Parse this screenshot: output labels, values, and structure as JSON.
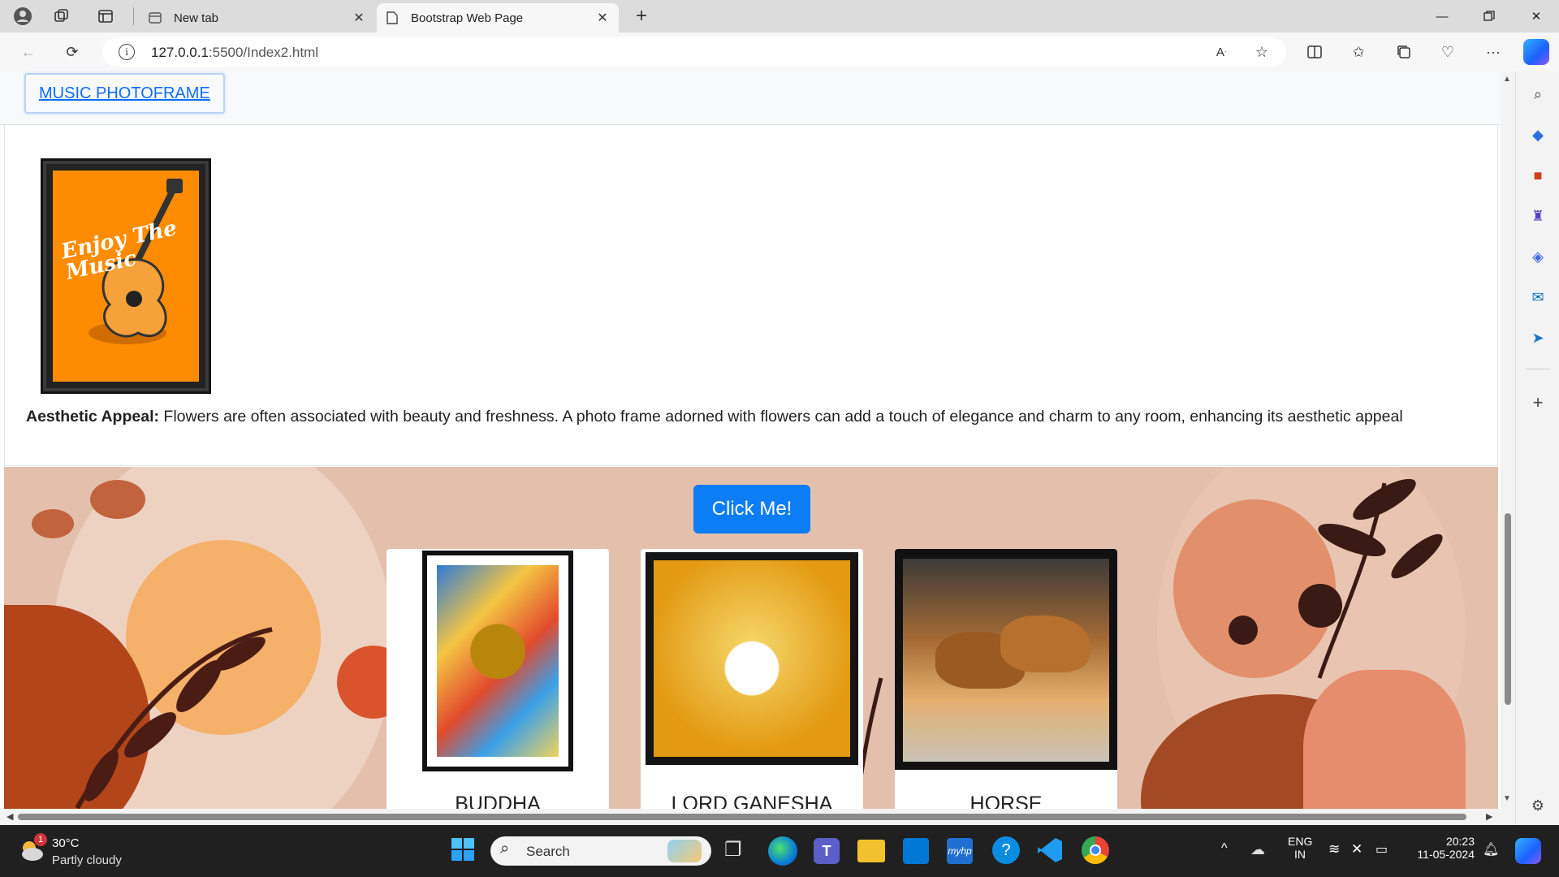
{
  "browser": {
    "tabs": [
      {
        "title": "New tab",
        "active": false
      },
      {
        "title": "Bootstrap Web Page",
        "active": true
      }
    ],
    "url_host": "127.0.0.1",
    "url_path": ":5500/Index2.html"
  },
  "page": {
    "nav_link": "MUSIC PHOTOFRAME",
    "poster_text": "Enjoy The Music",
    "desc_bold": "Aesthetic Appeal:",
    "desc_text": " Flowers are often associated with beauty and freshness. A photo frame adorned with flowers can add a touch of elegance and charm to any room, enhancing its aesthetic appeal",
    "click_button": "Click Me!",
    "products": [
      {
        "name": "BUDDHA"
      },
      {
        "name": "LORD GANESHA"
      },
      {
        "name": "HORSE"
      }
    ]
  },
  "taskbar": {
    "weather_temp": "30°C",
    "weather_desc": "Partly cloudy",
    "weather_badge": "1",
    "search_placeholder": "Search",
    "lang_top": "ENG",
    "lang_bottom": "IN",
    "time": "20:23",
    "date": "11-05-2024"
  },
  "colors": {
    "accent": "#0d6efd",
    "button": "#0d7df5",
    "taskbar": "#202020",
    "poster": "#ff8c00"
  }
}
